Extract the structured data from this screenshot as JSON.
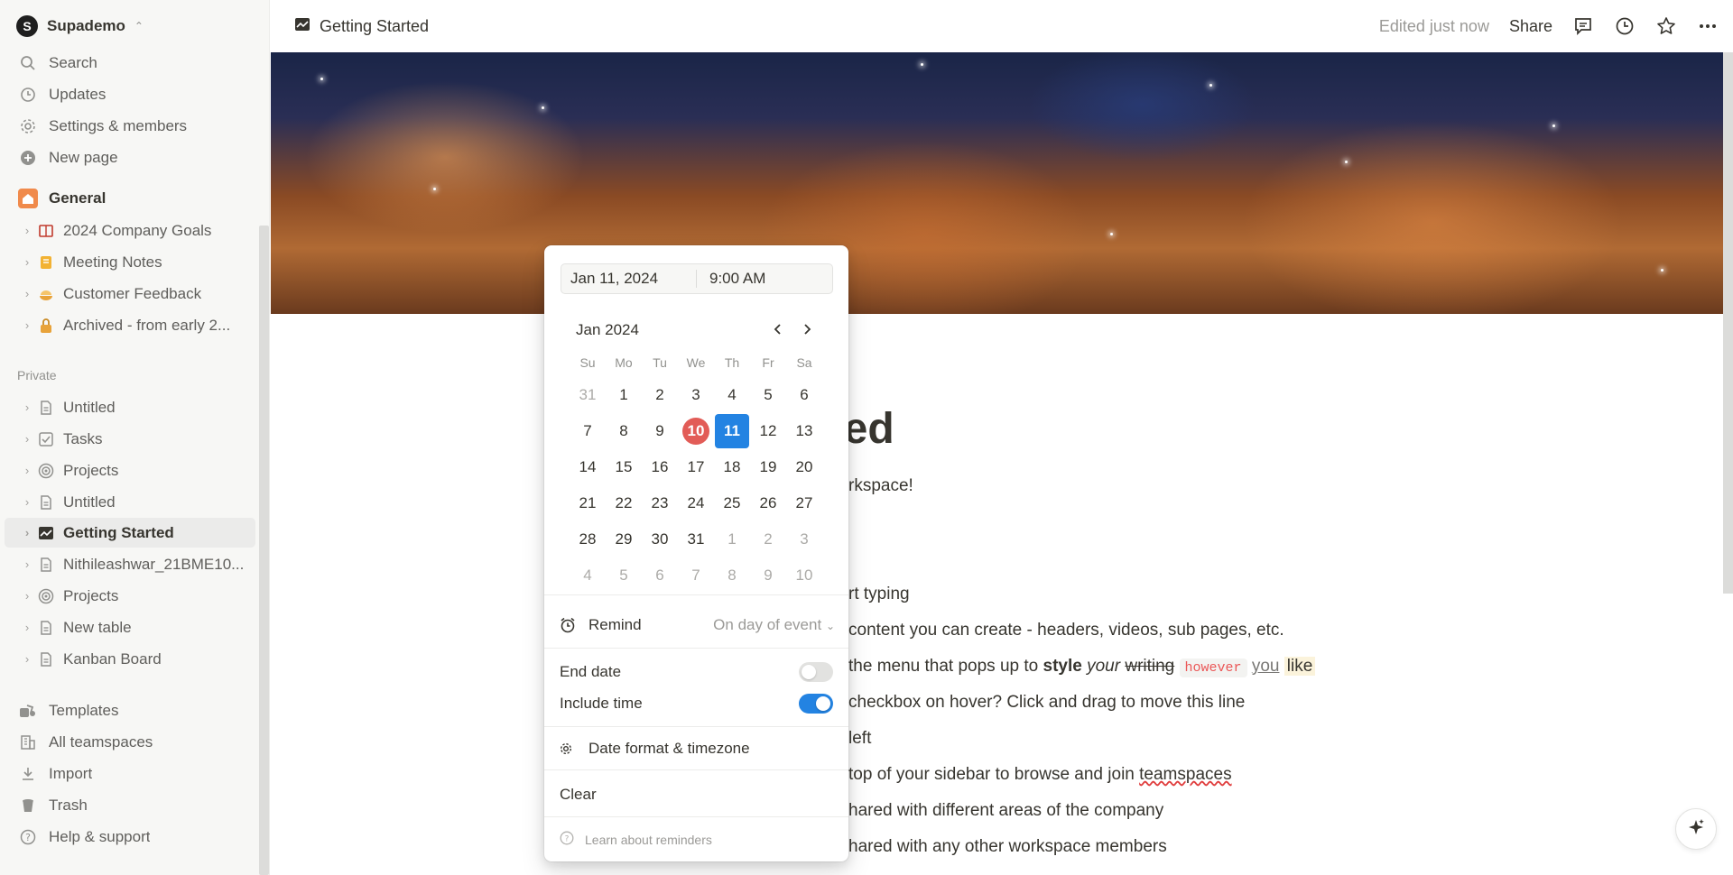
{
  "workspace": {
    "initial": "S",
    "name": "Supademo"
  },
  "sidebar": {
    "top_items": [
      {
        "label": "Search",
        "icon": "search-icon"
      },
      {
        "label": "Updates",
        "icon": "clock-icon"
      },
      {
        "label": "Settings & members",
        "icon": "gear-icon"
      },
      {
        "label": "New page",
        "icon": "plus-circle-icon"
      }
    ],
    "teamspace": {
      "name": "General",
      "items": [
        {
          "label": "2024 Company Goals",
          "icon": "book-icon"
        },
        {
          "label": "Meeting Notes",
          "icon": "notebook-icon"
        },
        {
          "label": "Customer Feedback",
          "icon": "pie-icon"
        },
        {
          "label": "Archived - from early 2...",
          "icon": "lock-icon"
        }
      ]
    },
    "private_label": "Private",
    "private_items": [
      {
        "label": "Untitled",
        "icon": "page-icon"
      },
      {
        "label": "Tasks",
        "icon": "checkbox-icon"
      },
      {
        "label": "Projects",
        "icon": "target-icon"
      },
      {
        "label": "Untitled",
        "icon": "page-icon"
      },
      {
        "label": "Getting Started",
        "icon": "chart-icon",
        "active": true
      },
      {
        "label": "Nithileashwar_21BME10...",
        "icon": "page-icon"
      },
      {
        "label": "Projects",
        "icon": "target-icon"
      },
      {
        "label": "New table",
        "icon": "page-icon"
      },
      {
        "label": "Kanban Board",
        "icon": "page-icon"
      }
    ],
    "bottom_items": [
      {
        "label": "Templates",
        "icon": "templates-icon"
      },
      {
        "label": "All teamspaces",
        "icon": "building-icon"
      },
      {
        "label": "Import",
        "icon": "import-icon"
      },
      {
        "label": "Trash",
        "icon": "trash-icon"
      },
      {
        "label": "Help & support",
        "icon": "help-icon"
      }
    ]
  },
  "topbar": {
    "breadcrumb": "Getting Started",
    "edited": "Edited just now",
    "share": "Share"
  },
  "page": {
    "title_visible": "rted",
    "subtitle_fragment": "rkspace!",
    "lines": [
      "rt typing",
      "content you can create - headers, videos, sub pages, etc.",
      "checkbox on hover? Click and drag to move this line",
      "left",
      "hared with different areas of the company",
      "hared with any other workspace members"
    ],
    "style_line": {
      "prefix": "the menu that pops up to ",
      "style": "style",
      "your": "your",
      "writing": "writing",
      "however": "however",
      "you": "you",
      "like": "like"
    },
    "teamspace_line": {
      "prefix": "top of your sidebar to browse and join ",
      "word": "teamspaces"
    }
  },
  "picker": {
    "date": "Jan 11, 2024",
    "time": "9:00 AM",
    "month_label": "Jan 2024",
    "weekdays": [
      "Su",
      "Mo",
      "Tu",
      "We",
      "Th",
      "Fr",
      "Sa"
    ],
    "weeks": [
      [
        "31",
        "1",
        "2",
        "3",
        "4",
        "5",
        "6"
      ],
      [
        "7",
        "8",
        "9",
        "10",
        "11",
        "12",
        "13"
      ],
      [
        "14",
        "15",
        "16",
        "17",
        "18",
        "19",
        "20"
      ],
      [
        "21",
        "22",
        "23",
        "24",
        "25",
        "26",
        "27"
      ],
      [
        "28",
        "29",
        "30",
        "31",
        "1",
        "2",
        "3"
      ],
      [
        "4",
        "5",
        "6",
        "7",
        "8",
        "9",
        "10"
      ]
    ],
    "today": "10",
    "selected": "11",
    "remind_label": "Remind",
    "remind_value": "On day of event",
    "end_date_label": "End date",
    "end_date_on": false,
    "include_time_label": "Include time",
    "include_time_on": true,
    "format_label": "Date format & timezone",
    "clear_label": "Clear",
    "learn_label": "Learn about reminders"
  },
  "colors": {
    "accent": "#2383e2",
    "today": "#e25c57"
  }
}
